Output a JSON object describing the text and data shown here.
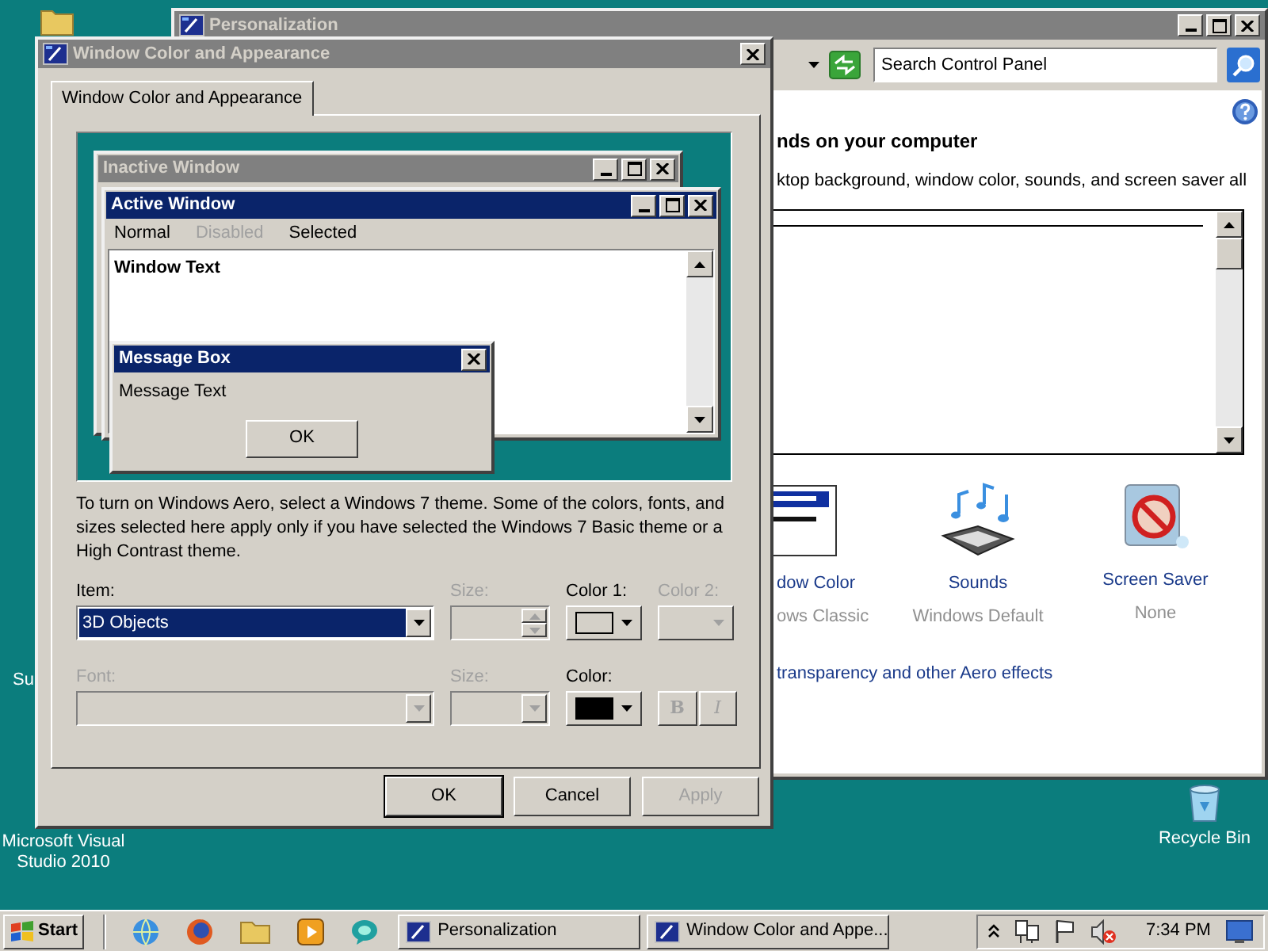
{
  "desktop": {
    "partial_label": "Su",
    "visual_studio": "Microsoft Visual Studio 2010",
    "recycle_bin": "Recycle Bin"
  },
  "personalization": {
    "title": "Personalization",
    "search": {
      "placeholder": "Search Control Panel"
    },
    "heading": "nds on your computer",
    "description": "ktop background, window color, sounds, and screen saver all",
    "items": [
      {
        "kind": "window_color",
        "label": "dow Color",
        "detail": "ows Classic"
      },
      {
        "kind": "sounds",
        "label": "Sounds",
        "detail": "Windows Default"
      },
      {
        "kind": "screen_saver",
        "label": "Screen Saver",
        "detail": "None"
      }
    ],
    "link": "transparency and other Aero effects"
  },
  "dialog": {
    "title": "Window Color and Appearance",
    "tabs": [
      {
        "label": "Window Color and Appearance",
        "selected": true
      }
    ],
    "preview": {
      "inactive_title": "Inactive Window",
      "active_title": "Active Window",
      "menu": [
        {
          "label": "Normal",
          "kind": "normal"
        },
        {
          "label": "Disabled",
          "kind": "disabled"
        },
        {
          "label": "Selected",
          "kind": "selected"
        }
      ],
      "window_text": "Window Text",
      "message_title": "Message Box",
      "message_text": "Message Text",
      "ok": "OK"
    },
    "note": "To turn on Windows Aero, select a Windows 7 theme.  Some of the colors, fonts, and sizes selected here apply only if you have selected the Windows 7 Basic theme or a High Contrast theme.",
    "rows": [
      {
        "fields": [
          {
            "kind": "combo",
            "label": "Item:",
            "value": "3D Objects",
            "disabled": false
          },
          {
            "kind": "spinner",
            "label": "Size:",
            "disabled": true
          },
          {
            "kind": "color",
            "label": "Color 1:",
            "disabled": false,
            "color": "#d4d0c8"
          },
          {
            "kind": "color",
            "label": "Color 2:",
            "disabled": true
          }
        ]
      },
      {
        "fields": [
          {
            "kind": "combo",
            "label": "Font:",
            "disabled": true
          },
          {
            "kind": "combo",
            "label": "Size:",
            "disabled": true
          },
          {
            "kind": "color",
            "label": "Color:",
            "disabled": false,
            "color": "#000000"
          },
          {
            "kind": "style",
            "disabled": true,
            "buttons": [
              {
                "label": "B",
                "kind": "bold"
              },
              {
                "label": "I",
                "kind": "italic"
              }
            ]
          }
        ]
      }
    ],
    "buttons": [
      {
        "label": "OK",
        "default": true,
        "disabled": false
      },
      {
        "label": "Cancel",
        "default": false,
        "disabled": false
      },
      {
        "label": "Apply",
        "default": false,
        "disabled": true
      }
    ]
  },
  "taskbar": {
    "start": "Start",
    "tasks": [
      {
        "label": "Personalization"
      },
      {
        "label": "Window Color and Appe..."
      }
    ],
    "clock": "7:34 PM"
  }
}
